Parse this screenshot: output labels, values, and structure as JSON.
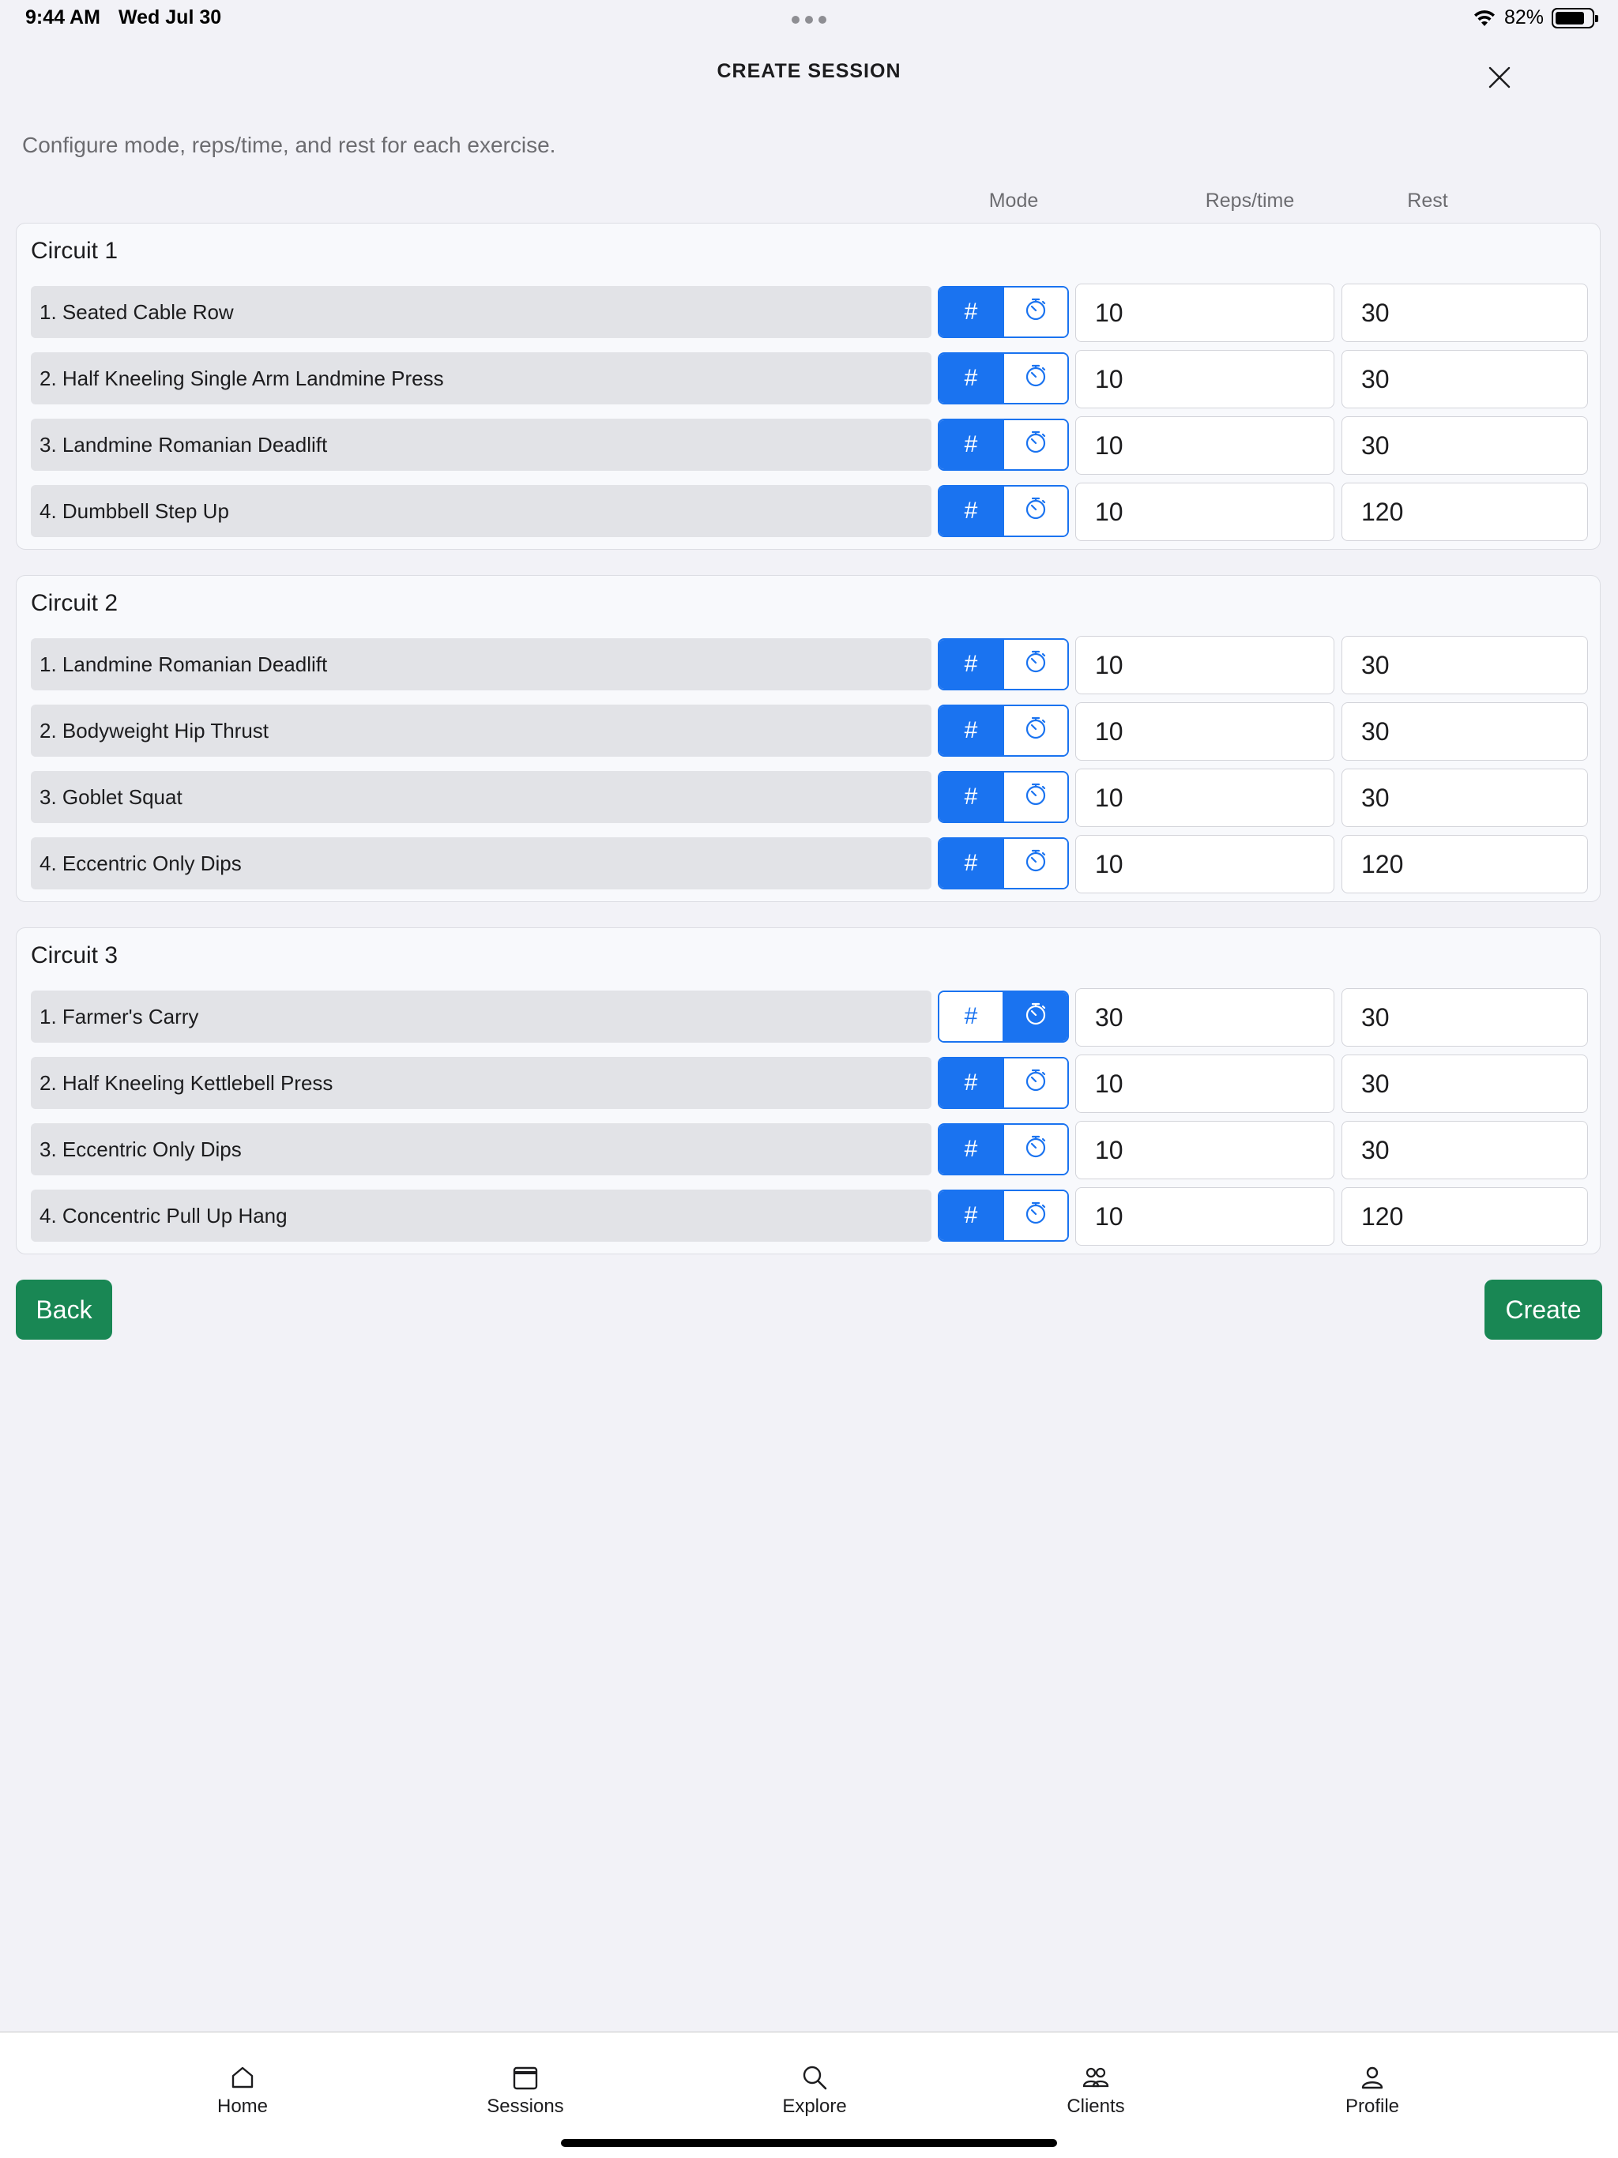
{
  "status_bar": {
    "time": "9:44 AM",
    "date": "Wed Jul 30",
    "battery": "82%"
  },
  "header": {
    "title": "CREATE SESSION",
    "subtitle": "Configure mode, reps/time, and rest for each exercise."
  },
  "columns": {
    "mode": "Mode",
    "reps": "Reps/time",
    "rest": "Rest"
  },
  "mode_icons": {
    "reps": "#",
    "time": "stopwatch-icon"
  },
  "colors": {
    "accent": "#1a73f0",
    "primary_button": "#198754"
  },
  "circuits": [
    {
      "title": "Circuit 1",
      "exercises": [
        {
          "name": "1. Seated Cable Row",
          "mode": "reps",
          "value": "10",
          "rest": "30"
        },
        {
          "name": "2. Half Kneeling Single Arm Landmine Press",
          "mode": "reps",
          "value": "10",
          "rest": "30"
        },
        {
          "name": "3. Landmine Romanian Deadlift",
          "mode": "reps",
          "value": "10",
          "rest": "30"
        },
        {
          "name": "4. Dumbbell Step Up",
          "mode": "reps",
          "value": "10",
          "rest": "120"
        }
      ]
    },
    {
      "title": "Circuit 2",
      "exercises": [
        {
          "name": "1. Landmine Romanian Deadlift",
          "mode": "reps",
          "value": "10",
          "rest": "30"
        },
        {
          "name": "2. Bodyweight Hip Thrust",
          "mode": "reps",
          "value": "10",
          "rest": "30"
        },
        {
          "name": "3. Goblet Squat",
          "mode": "reps",
          "value": "10",
          "rest": "30"
        },
        {
          "name": "4. Eccentric Only Dips",
          "mode": "reps",
          "value": "10",
          "rest": "120"
        }
      ]
    },
    {
      "title": "Circuit 3",
      "exercises": [
        {
          "name": "1. Farmer's Carry",
          "mode": "time",
          "value": "30",
          "rest": "30"
        },
        {
          "name": "2. Half Kneeling Kettlebell Press",
          "mode": "reps",
          "value": "10",
          "rest": "30"
        },
        {
          "name": "3. Eccentric Only Dips",
          "mode": "reps",
          "value": "10",
          "rest": "30"
        },
        {
          "name": "4. Concentric Pull Up Hang",
          "mode": "reps",
          "value": "10",
          "rest": "120"
        }
      ]
    }
  ],
  "buttons": {
    "back": "Back",
    "create": "Create"
  },
  "tabs": [
    {
      "label": "Home",
      "icon": "home-icon"
    },
    {
      "label": "Sessions",
      "icon": "calendar-icon"
    },
    {
      "label": "Explore",
      "icon": "search-icon"
    },
    {
      "label": "Clients",
      "icon": "people-icon"
    },
    {
      "label": "Profile",
      "icon": "person-icon"
    }
  ]
}
